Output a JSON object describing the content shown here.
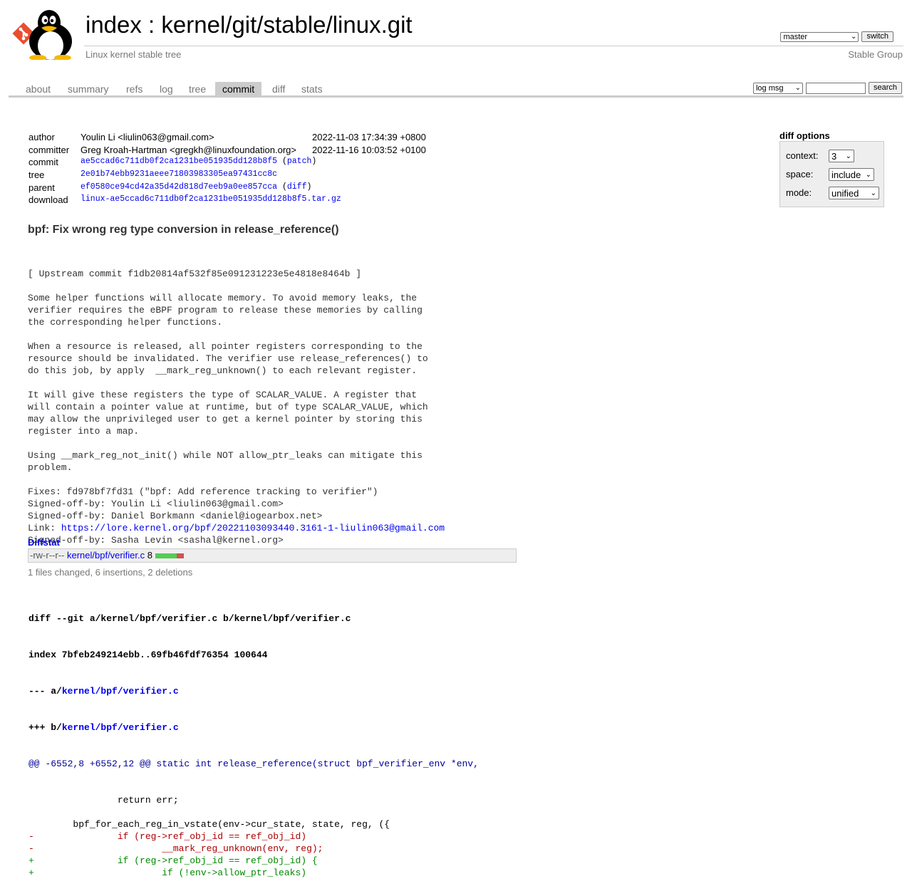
{
  "header": {
    "title_index": "index",
    "title_sep": " : ",
    "title_repo": "kernel/git/stable/linux.git",
    "subtitle": "Linux kernel stable tree",
    "owner": "Stable Group",
    "branch": "master",
    "switch_label": "switch"
  },
  "tabs": [
    "about",
    "summary",
    "refs",
    "log",
    "tree",
    "commit",
    "diff",
    "stats"
  ],
  "active_tab": "commit",
  "search": {
    "mode": "log msg",
    "value": "",
    "button": "search"
  },
  "diff_options": {
    "title": "diff options",
    "context_label": "context:",
    "context_value": "3",
    "space_label": "space:",
    "space_value": "include",
    "mode_label": "mode:",
    "mode_value": "unified"
  },
  "commit_info": {
    "author_label": "author",
    "author": "Youlin Li <liulin063@gmail.com>",
    "author_date": "2022-11-03 17:34:39 +0800",
    "committer_label": "committer",
    "committer": "Greg Kroah-Hartman <gregkh@linuxfoundation.org>",
    "committer_date": "2022-11-16 10:03:52 +0100",
    "commit_label": "commit",
    "commit_hash": "ae5ccad6c711db0f2ca1231be051935dd128b8f5",
    "commit_extra": "patch",
    "tree_label": "tree",
    "tree_hash": "2e01b74ebb9231aeee71803983305ea97431cc8c",
    "parent_label": "parent",
    "parent_hash": "ef0580ce94cd42a35d42d818d7eeb9a0ee857cca",
    "parent_extra": "diff",
    "download_label": "download",
    "download_file": "linux-ae5ccad6c711db0f2ca1231be051935dd128b8f5.tar.gz"
  },
  "subject": "bpf: Fix wrong reg type conversion in release_reference()",
  "message_lines": [
    "[ Upstream commit f1db20814af532f85e091231223e5e4818e8464b ]",
    "",
    "Some helper functions will allocate memory. To avoid memory leaks, the",
    "verifier requires the eBPF program to release these memories by calling",
    "the corresponding helper functions.",
    "",
    "When a resource is released, all pointer registers corresponding to the",
    "resource should be invalidated. The verifier use release_references() to",
    "do this job, by apply  __mark_reg_unknown() to each relevant register.",
    "",
    "It will give these registers the type of SCALAR_VALUE. A register that",
    "will contain a pointer value at runtime, but of type SCALAR_VALUE, which",
    "may allow the unprivileged user to get a kernel pointer by storing this",
    "register into a map.",
    "",
    "Using __mark_reg_not_init() while NOT allow_ptr_leaks can mitigate this",
    "problem.",
    "",
    "Fixes: fd978bf7fd31 (\"bpf: Add reference tracking to verifier\")",
    "Signed-off-by: Youlin Li <liulin063@gmail.com>",
    "Signed-off-by: Daniel Borkmann <daniel@iogearbox.net>"
  ],
  "link_label": "Link: ",
  "link_url": "https://lore.kernel.org/bpf/20221103093440.3161-1-liulin063@gmail.com",
  "message_last": "Signed-off-by: Sasha Levin <sashal@kernel.org>",
  "diffstat": {
    "title": "Diffstat",
    "mode": "-rw-r--r--",
    "file": "kernel/bpf/verifier.c",
    "count": "8",
    "insertions": 6,
    "deletions": 2,
    "summary": "1 files changed, 6 insertions, 2 deletions"
  },
  "diff": {
    "git_line": "diff --git a/kernel/bpf/verifier.c b/kernel/bpf/verifier.c",
    "index_line": "index 7bfeb249214ebb..69fb46fdf76354 100644",
    "minus_prefix": "--- a/",
    "minus_file": "kernel/bpf/verifier.c",
    "plus_prefix": "+++ b/",
    "plus_file": "kernel/bpf/verifier.c",
    "hunk": "@@ -6552,8 +6552,12 @@ static int release_reference(struct bpf_verifier_env *env,",
    "lines": [
      {
        "type": "ctx",
        "text": " \t\treturn err;"
      },
      {
        "type": "ctx",
        "text": " "
      },
      {
        "type": "ctx",
        "text": " \tbpf_for_each_reg_in_vstate(env->cur_state, state, reg, ({"
      },
      {
        "type": "del",
        "text": "-\t\tif (reg->ref_obj_id == ref_obj_id)"
      },
      {
        "type": "del",
        "text": "-\t\t\t__mark_reg_unknown(env, reg);"
      },
      {
        "type": "add",
        "text": "+\t\tif (reg->ref_obj_id == ref_obj_id) {"
      },
      {
        "type": "add",
        "text": "+\t\t\tif (!env->allow_ptr_leaks)"
      }
    ]
  }
}
